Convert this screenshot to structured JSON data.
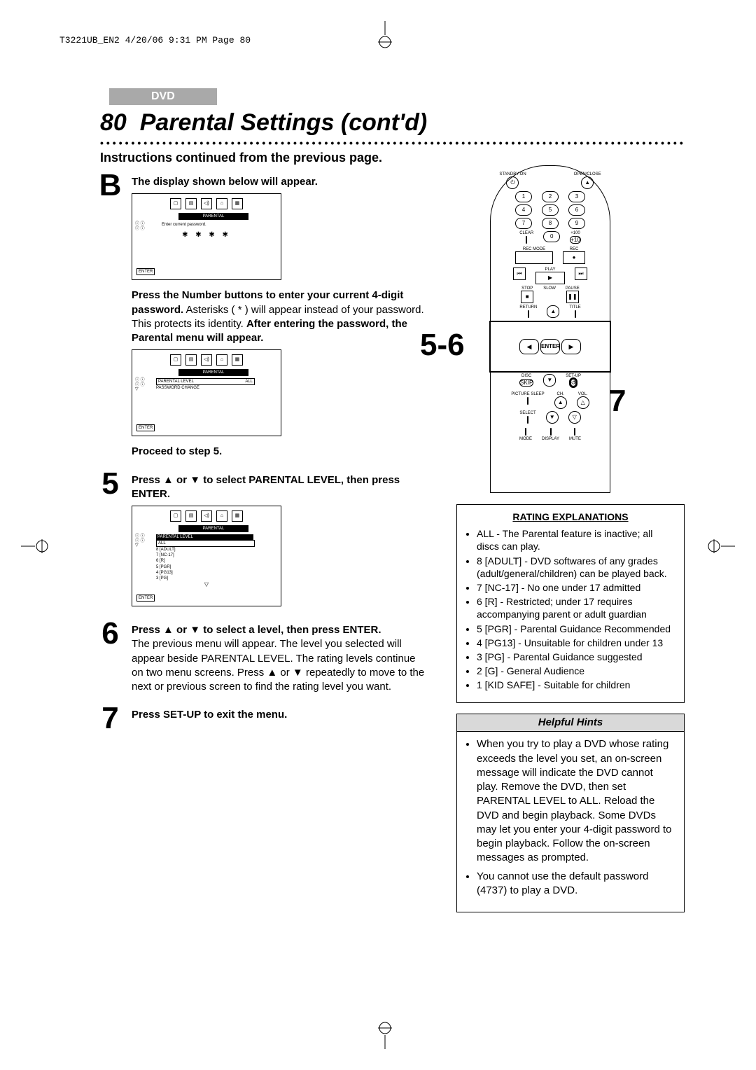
{
  "header_line": "T3221UB_EN2  4/20/06  9:31 PM  Page 80",
  "chip": "DVD",
  "page_number": "80",
  "title": "Parental Settings (cont'd)",
  "subhead": "Instructions continued from the previous page.",
  "steps": {
    "B": {
      "intro_bold": "The display shown below will appear.",
      "screen1": {
        "toplabel": "PARENTAL",
        "prompt": "Enter current password.",
        "mask": "✱ ✱ ✱ ✱",
        "side1": "ⓘⓘ",
        "side2": "ⓘⓘ",
        "enter": "ENTER"
      },
      "para1a_bold": "Press the Number buttons to enter your current 4-digit password.",
      "para1b": "  Asterisks ( * ) will appear instead of your password. This protects its identity.  ",
      "para1c_bold": "After entering the password, the Parental menu will appear.",
      "screen2": {
        "toplabel": "PARENTAL",
        "line1": "PARENTAL LEVEL",
        "line1_val": "ALL",
        "line2": "PASSWORD CHANGE",
        "enter": "ENTER"
      },
      "proceed": "Proceed to step 5."
    },
    "5": {
      "text_a_bold": "Press ▲ or ▼ to select PARENTAL LEVEL, then press ENTER.",
      "screen": {
        "toplabel": "PARENTAL",
        "header": "PARENTAL LEVEL",
        "list": [
          "ALL",
          "8 [ADULT]",
          "7 [NC-17]",
          "6 [R]",
          "5 [PGR]",
          "4 [PG13]",
          "3 [PG]"
        ],
        "down": "▽",
        "enter": "ENTER"
      }
    },
    "6": {
      "text_bold": "Press ▲ or ▼ to select a level, then press ENTER.",
      "para": "The previous menu will appear. The level you selected will appear beside PARENTAL LEVEL. The rating levels continue on two menu screens.  Press ▲ or ▼ repeatedly to move to the next or previous screen to find the rating level you want."
    },
    "7": {
      "text_bold": "Press SET-UP to exit the menu."
    }
  },
  "callouts": {
    "five_six": "5-6",
    "seven": "7"
  },
  "remote": {
    "top_left": "STANDBY-ON",
    "top_right": "OPEN/CLOSE",
    "numbers": [
      "1",
      "2",
      "3",
      "4",
      "5",
      "6",
      "7",
      "8",
      "9",
      "0"
    ],
    "clear": "CLEAR",
    "plus100": "+100",
    "plus10": "+10",
    "recmode": "REC MODE",
    "rec": "REC",
    "rec_dot": "●",
    "play": "PLAY",
    "stop": "STOP",
    "slow": "SLOW",
    "pause": "PAUSE",
    "return": "RETURN",
    "title": "TITLE",
    "disc": "DISC",
    "setup": "SET-UP",
    "skb": "SKIP",
    "enter": "ENTER",
    "picture_sleep": "PICTURE SLEEP",
    "ch": "CH.",
    "vol": "VOL.",
    "select": "SELECT",
    "mode": "MODE",
    "display": "DISPLAY",
    "mute": "MUTE"
  },
  "ratings": {
    "heading": "RATING EXPLANATIONS",
    "items": [
      "ALL - The Parental feature is inactive; all discs can play.",
      "8 [ADULT] - DVD softwares of any grades (adult/general/children) can be played back.",
      "7 [NC-17] - No one under 17 admitted",
      "6 [R] - Restricted; under 17 requires accompanying parent or adult guardian",
      "5 [PGR] - Parental Guidance Recommended",
      "4 [PG13] - Unsuitable for children under 13",
      "3 [PG] - Parental Guidance suggested",
      "2 [G] - General Audience",
      "1 [KID SAFE] - Suitable for children"
    ]
  },
  "hints": {
    "heading": "Helpful Hints",
    "items": [
      "When you try to play a DVD whose rating exceeds the level you set, an on-screen message will indicate the DVD cannot play. Remove the DVD, then set PARENTAL LEVEL to ALL. Reload the DVD and begin playback. Some DVDs may let you enter your 4-digit password to begin playback. Follow the on-screen messages as prompted.",
      "You cannot use the default password (4737) to play a DVD."
    ]
  }
}
